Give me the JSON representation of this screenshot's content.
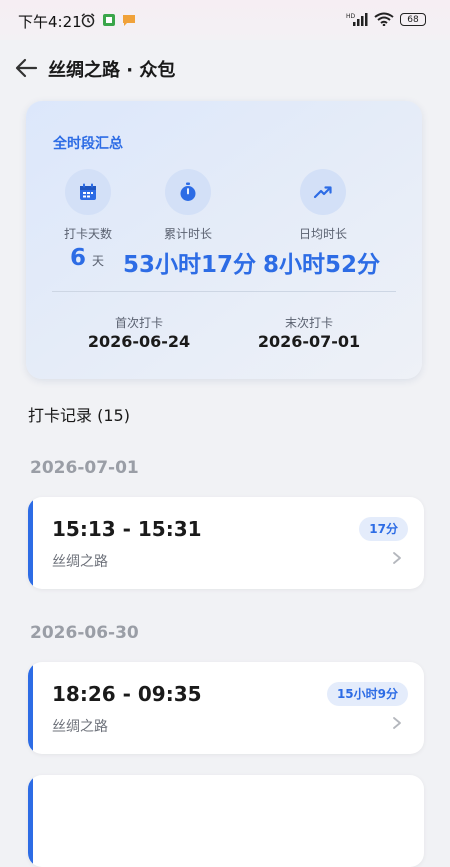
{
  "status_bar": {
    "time": "下午4:21",
    "battery": "68"
  },
  "header": {
    "title": "丝绸之路 · 众包"
  },
  "summary": {
    "title": "全时段汇总",
    "days_label": "打卡天数",
    "days_value": "6",
    "days_unit": "天",
    "total_label": "累计时长",
    "total_value": "53小时17分",
    "avg_label": "日均时长",
    "avg_value": "8小时52分",
    "first_label": "首次打卡",
    "first_value": "2026-06-24",
    "last_label": "末次打卡",
    "last_value": "2026-07-01"
  },
  "records": {
    "heading": "打卡记录 (15)",
    "groups": [
      {
        "date": "2026-07-01",
        "entries": [
          {
            "time": "15:13 - 15:31",
            "place": "丝绸之路",
            "duration": "17分"
          }
        ]
      },
      {
        "date": "2026-06-30",
        "entries": [
          {
            "time": "18:26 - 09:35",
            "place": "丝绸之路",
            "duration": "15小时9分"
          }
        ]
      }
    ]
  },
  "colors": {
    "accent": "#2d6ce5",
    "background": "#f1f2f5"
  }
}
